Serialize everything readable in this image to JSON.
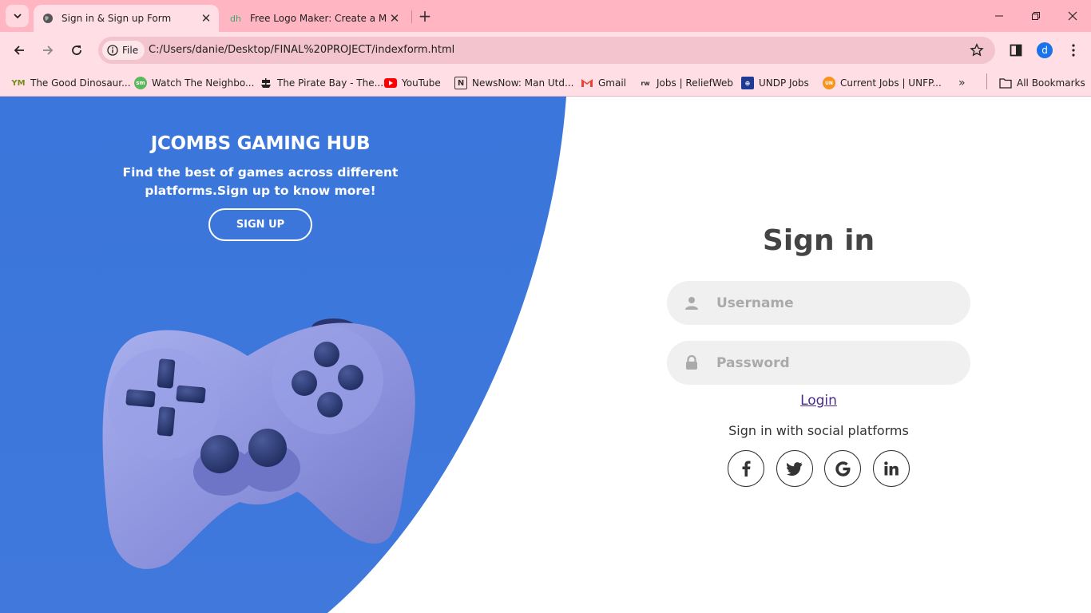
{
  "browser": {
    "tabs": [
      {
        "title": "Sign in & Sign up Form"
      },
      {
        "title": "Free Logo Maker: Create a Mod"
      }
    ],
    "address": {
      "chip": "File",
      "url": "C:/Users/danie/Desktop/FINAL%20PROJECT/indexform.html"
    },
    "profile_initial": "d",
    "bookmarks": [
      {
        "label": "The Good Dinosaur...",
        "icon": "YM"
      },
      {
        "label": "Watch The Neighbo...",
        "icon": "sm"
      },
      {
        "label": "The Pirate Bay - The...",
        "icon": "pirate"
      },
      {
        "label": "YouTube",
        "icon": "youtube"
      },
      {
        "label": "NewsNow: Man Utd...",
        "icon": "N"
      },
      {
        "label": "Gmail",
        "icon": "gmail"
      },
      {
        "label": "Jobs | ReliefWeb",
        "icon": "rw"
      },
      {
        "label": "UNDP Jobs",
        "icon": "undp"
      },
      {
        "label": "Current Jobs | UNFP...",
        "icon": "unfpa"
      }
    ],
    "all_bookmarks": "All Bookmarks"
  },
  "hero": {
    "title": "JCOMBS GAMING HUB",
    "text": "Find the best of games across different platforms.Sign up to know more!",
    "signup_label": "SIGN UP"
  },
  "signin": {
    "title": "Sign in",
    "username_placeholder": "Username",
    "password_placeholder": "Password",
    "login_label": "Login",
    "social_text": "Sign in with social platforms",
    "social": [
      {
        "glyph": "f",
        "icon": "facebook-icon"
      },
      {
        "glyph": "twitter",
        "icon": "twitter-icon"
      },
      {
        "glyph": "G",
        "icon": "google-icon"
      },
      {
        "glyph": "in",
        "icon": "linkedin-icon"
      }
    ]
  },
  "colors": {
    "accent_blue": "#3b78dc",
    "chrome_pink": "#ffb5c2",
    "field_bg": "#f0f0f0"
  }
}
